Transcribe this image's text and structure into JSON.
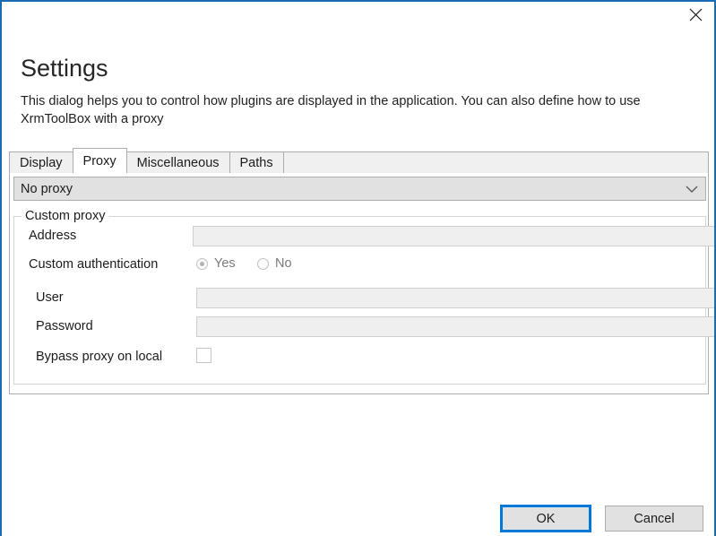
{
  "window": {
    "close_icon": "close-icon",
    "border_color": "#1a6cb0"
  },
  "header": {
    "title": "Settings",
    "description": "This dialog helps you to control how plugins are displayed in the application. You can also define how to use XrmToolBox with a proxy"
  },
  "tabs": [
    {
      "label": "Display",
      "selected": false
    },
    {
      "label": "Proxy",
      "selected": true
    },
    {
      "label": "Miscellaneous",
      "selected": false
    },
    {
      "label": "Paths",
      "selected": false
    }
  ],
  "proxy_tab": {
    "mode_combo": {
      "value": "No proxy",
      "arrow_icon": "chevron-down-icon"
    },
    "group": {
      "legend": "Custom proxy",
      "address": {
        "label": "Address",
        "value": "",
        "placeholder": ""
      },
      "custom_authentication": {
        "label": "Custom authentication",
        "options": [
          {
            "label": "Yes",
            "checked": true
          },
          {
            "label": "No",
            "checked": false
          }
        ]
      },
      "user": {
        "label": "User",
        "value": "",
        "placeholder": ""
      },
      "password": {
        "label": "Password",
        "value": "",
        "placeholder": ""
      },
      "bypass": {
        "label": "Bypass proxy on local",
        "checked": false
      }
    }
  },
  "footer": {
    "ok_label": "OK",
    "cancel_label": "Cancel",
    "accent_color": "#0078d7"
  }
}
